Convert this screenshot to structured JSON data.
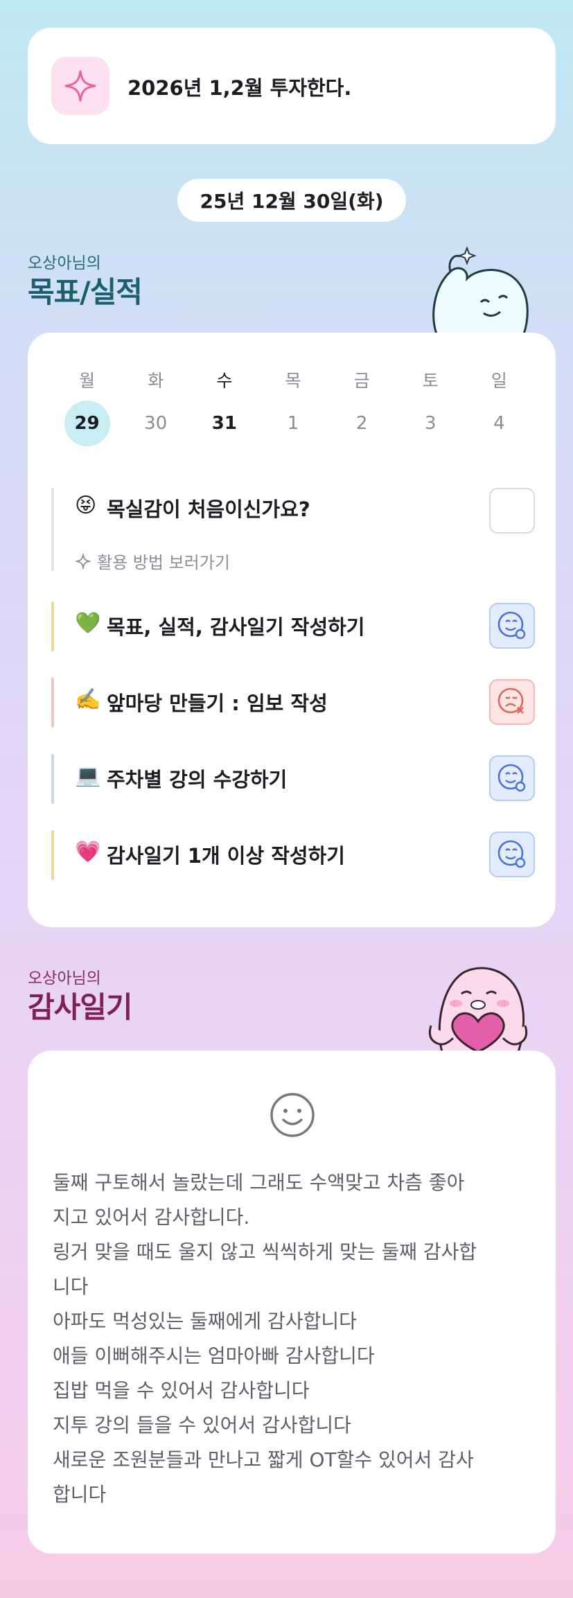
{
  "goal": {
    "text": "2026년 1,2월 투자한다.",
    "icon": "sparkle-icon"
  },
  "date_pill": "25년 12월 30일(화)",
  "goals_section": {
    "subtitle": "오상아님의",
    "title": "목표/실적"
  },
  "calendar": {
    "weekdays": [
      "월",
      "화",
      "수",
      "목",
      "금",
      "토",
      "일"
    ],
    "dates": [
      "29",
      "30",
      "31",
      "1",
      "2",
      "3",
      "4"
    ]
  },
  "intro_task": {
    "emoji": "😝",
    "label": "목실감이 처음이신가요?",
    "howto": "활용 방법 보러가기"
  },
  "tasks": [
    {
      "emoji": "💚",
      "label": "목표, 실적, 감사일기 작성하기",
      "status": "done",
      "accent": "#f3d79a"
    },
    {
      "emoji": "✍️",
      "label": "앞마당 만들기 : 임보 작성",
      "status": "failed",
      "accent": "#f5c6bf"
    },
    {
      "emoji": "💻",
      "label": "주차별 강의 수강하기",
      "status": "done",
      "accent": "#c7d6ef"
    },
    {
      "emoji": "💗",
      "label": "감사일기 1개 이상 작성하기",
      "status": "done",
      "accent": "#f3d79a"
    }
  ],
  "diary_section": {
    "subtitle": "오상아님의",
    "title": "감사일기"
  },
  "diary": {
    "lines": [
      "둘째 구토해서 놀랐는데 그래도 수액맞고 차츰 좋아",
      "지고 있어서 감사합니다.",
      "링거 맞을 때도 울지 않고 씩씩하게 맞는 둘째 감사합",
      "니다",
      "아파도 먹성있는 둘째에게 감사합니다",
      "애들 이뻐해주시는 엄마아빠 감사합니다",
      "집밥 먹을 수 있어서 감사합니다",
      "지투 강의 들을 수 있어서 감사합니다",
      "새로운 조원분들과 만나고 짧게 OT할수 있어서 감사",
      "합니다"
    ]
  },
  "colors": {
    "today_circle": "#c8edf3",
    "done_icon": "#4a6fd6",
    "failed_icon": "#e0665a"
  }
}
